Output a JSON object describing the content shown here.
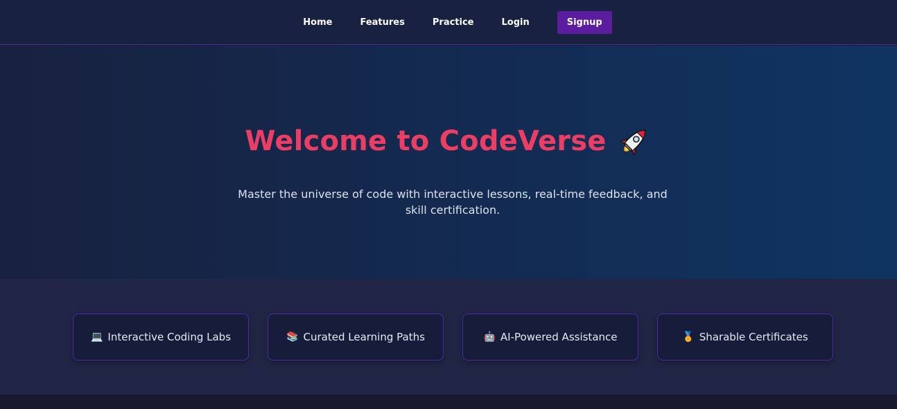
{
  "nav": {
    "items": [
      {
        "label": "Home"
      },
      {
        "label": "Features"
      },
      {
        "label": "Practice"
      },
      {
        "label": "Login"
      }
    ],
    "signup_label": "Signup"
  },
  "hero": {
    "title": "Welcome to CodeVerse",
    "title_icon": "rocket-icon",
    "subtitle": "Master the universe of code with interactive lessons, real-time feedback, and skill certification."
  },
  "features": [
    {
      "icon": "💻",
      "icon_name": "laptop-icon",
      "label": "Interactive Coding Labs"
    },
    {
      "icon": "📚",
      "icon_name": "books-icon",
      "label": "Curated Learning Paths"
    },
    {
      "icon": "🤖",
      "icon_name": "robot-icon",
      "label": "AI-Powered Assistance"
    },
    {
      "icon": "🏅",
      "icon_name": "medal-icon",
      "label": "Sharable Certificates"
    }
  ],
  "colors": {
    "accent": "#ec3e64",
    "signup_bg": "#5b1c9f",
    "card_border": "#4b2aa6",
    "navbar_bg": "#182240"
  }
}
